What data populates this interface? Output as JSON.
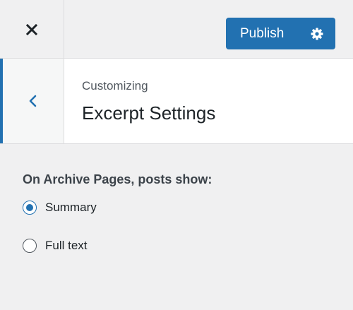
{
  "topbar": {
    "close_icon": "close-icon",
    "publish_label": "Publish",
    "settings_icon": "gear-icon",
    "accent_color": "#2271b1"
  },
  "section": {
    "back_icon": "chevron-left-icon",
    "eyebrow": "Customizing",
    "title": "Excerpt Settings"
  },
  "control": {
    "title": "On Archive Pages, posts show:",
    "options": [
      {
        "label": "Summary",
        "checked": true
      },
      {
        "label": "Full text",
        "checked": false
      }
    ]
  }
}
